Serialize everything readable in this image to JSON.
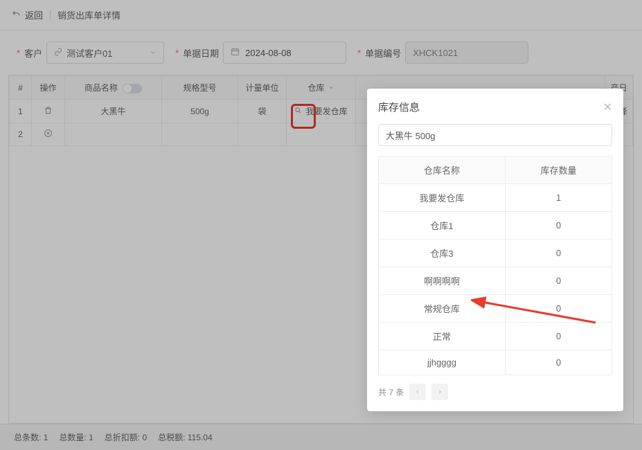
{
  "header": {
    "back": "返回",
    "title": "销货出库单详情"
  },
  "form": {
    "customer_label": "客户",
    "customer_value": "测试客户01",
    "date_label": "单据日期",
    "date_value": "2024-08-08",
    "no_label": "单据编号",
    "no_value": "XHCK1021"
  },
  "table": {
    "headers": {
      "idx": "#",
      "op": "操作",
      "name": "商品名称",
      "spec": "规格型号",
      "unit": "计量单位",
      "warehouse": "仓库",
      "prodday": "产日",
      "select": "选择"
    },
    "rows": [
      {
        "idx": "1",
        "name": "大黑牛",
        "spec": "500g",
        "unit": "袋",
        "warehouse": "我要发仓库"
      },
      {
        "idx": "2",
        "name": "",
        "spec": "",
        "unit": "",
        "warehouse": ""
      }
    ]
  },
  "modal": {
    "title": "库存信息",
    "search_value": "大黑牛 500g",
    "col_name": "仓库名称",
    "col_qty": "库存数量",
    "rows": [
      {
        "name": "我要发仓库",
        "qty": "1"
      },
      {
        "name": "仓库1",
        "qty": "0"
      },
      {
        "name": "仓库3",
        "qty": "0"
      },
      {
        "name": "啊啊啊啊",
        "qty": "0"
      },
      {
        "name": "常规仓库",
        "qty": "0"
      },
      {
        "name": "正常",
        "qty": "0"
      },
      {
        "name": "jjhgggg",
        "qty": "0"
      }
    ],
    "total": "共 7 条"
  },
  "footer": {
    "count_label": "总条数:",
    "count": "1",
    "qty_label": "总数量:",
    "qty": "1",
    "disc_label": "总折扣额:",
    "disc": "0",
    "tax_label": "总税额:",
    "tax": "115.04"
  }
}
